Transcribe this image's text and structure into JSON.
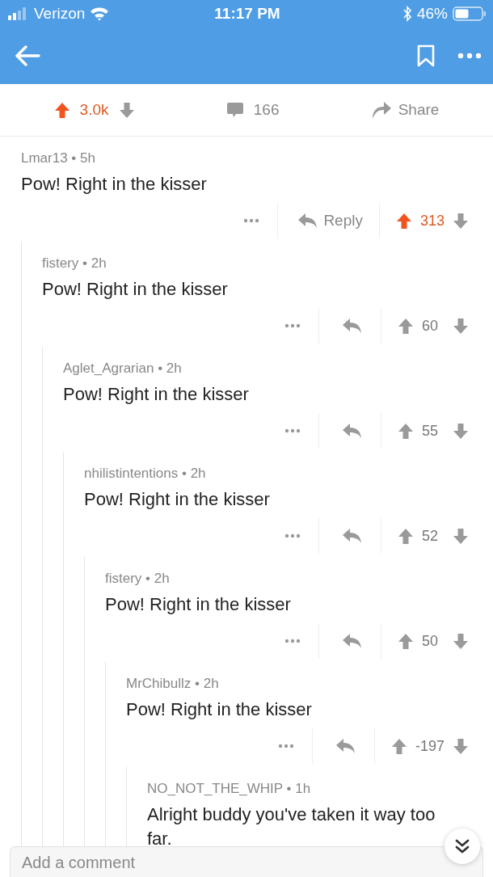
{
  "status_bar": {
    "carrier": "Verizon",
    "time": "11:17 PM",
    "battery": "46%"
  },
  "post_actions": {
    "score": "3.0k",
    "upvoted": true,
    "comments": "166",
    "share": "Share"
  },
  "comments": [
    {
      "byline": "Lmar13 • 5h",
      "body": "Pow! Right in the kisser",
      "reply_label": "Reply",
      "score": "313",
      "upvoted": true,
      "children": [
        {
          "byline": "fistery • 2h",
          "body": "Pow! Right in the kisser",
          "score": "60",
          "upvoted": false,
          "children": [
            {
              "byline": "Aglet_Agrarian • 2h",
              "body": "Pow! Right in the kisser",
              "score": "55",
              "upvoted": false,
              "children": [
                {
                  "byline": "nhilistintentions • 2h",
                  "body": "Pow! Right in the kisser",
                  "score": "52",
                  "upvoted": false,
                  "children": [
                    {
                      "byline": "fistery • 2h",
                      "body": "Pow! Right in the kisser",
                      "score": "50",
                      "upvoted": false,
                      "children": [
                        {
                          "byline": "MrChibullz • 2h",
                          "body": "Pow! Right in the kisser",
                          "score": "-197",
                          "upvoted": false,
                          "children": [
                            {
                              "byline": "NO_NOT_THE_WHIP • 1h",
                              "body": "Alright buddy you've taken it way too far."
                            }
                          ]
                        }
                      ]
                    }
                  ]
                }
              ]
            }
          ]
        }
      ]
    }
  ],
  "comment_field": {
    "placeholder": "Add a comment"
  }
}
